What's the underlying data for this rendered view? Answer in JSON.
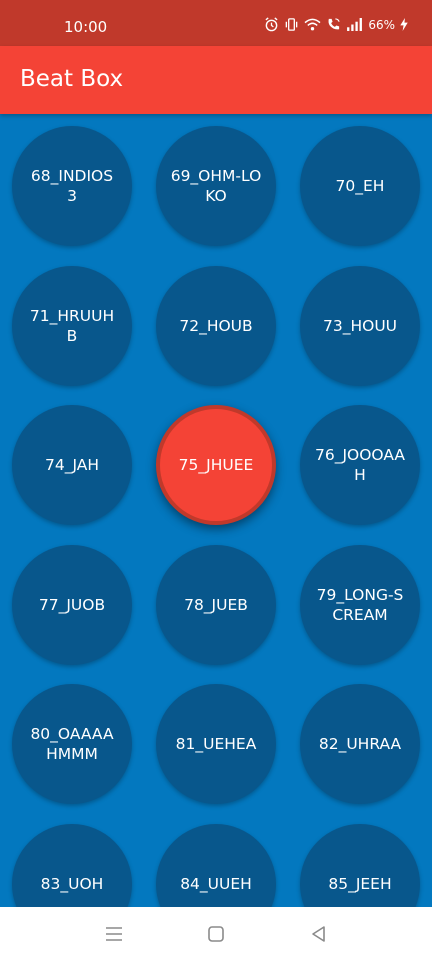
{
  "status_bar": {
    "time": "10:00",
    "battery": "66%",
    "icons": [
      "alarm-icon",
      "vibrate-icon",
      "wifi-icon",
      "wifi-calling-icon",
      "signal-icon",
      "charging-icon"
    ]
  },
  "app_bar": {
    "title": "Beat Box",
    "color": "#f44336"
  },
  "colors": {
    "background": "#0378bf",
    "button": "#08578c",
    "button_pressed": "#f44336"
  },
  "sounds": [
    {
      "label": "68_INDIOS3"
    },
    {
      "label": "69_OHM-LOKO"
    },
    {
      "label": "70_EH"
    },
    {
      "label": "71_HRUUHB"
    },
    {
      "label": "72_HOUB"
    },
    {
      "label": "73_HOUU"
    },
    {
      "label": "74_JAH"
    },
    {
      "label": "75_JHUEE",
      "pressed": true
    },
    {
      "label": "76_JOOOAAH"
    },
    {
      "label": "77_JUOB"
    },
    {
      "label": "78_JUEB"
    },
    {
      "label": "79_LONG-SCREAM"
    },
    {
      "label": "80_OAAAAHMMM"
    },
    {
      "label": "81_UEHEA"
    },
    {
      "label": "82_UHRAA"
    },
    {
      "label": "83_UOH"
    },
    {
      "label": "84_UUEH"
    },
    {
      "label": "85_JEEH"
    }
  ],
  "nav_bar": {
    "icons": [
      "menu-icon",
      "home-square-icon",
      "back-triangle-icon"
    ]
  }
}
